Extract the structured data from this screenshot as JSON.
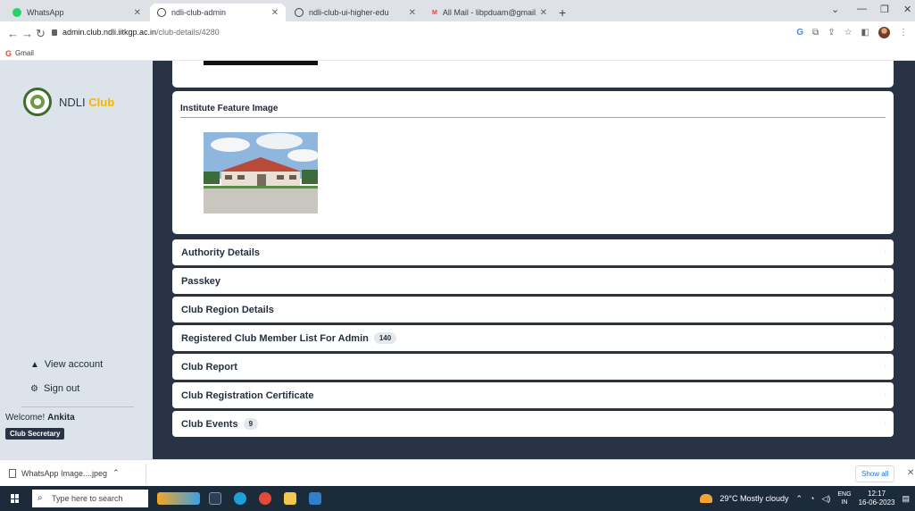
{
  "browser": {
    "tabs": [
      {
        "title": "WhatsApp",
        "favicon_color": "#25d366"
      },
      {
        "title": "ndli-club-admin",
        "favicon_color": "#3c4043"
      },
      {
        "title": "ndli-club-ui-higher-edu",
        "favicon_color": "#3c4043"
      },
      {
        "title": "All Mail - libpduam@gmail.com",
        "favicon_color": "#ea4335"
      }
    ],
    "url_host": "admin.club.ndli.iitkgp.ac.in",
    "url_path": "/club-details/4280",
    "bookmark": "Gmail"
  },
  "sidebar": {
    "brand_prefix": "NDLI",
    "brand_suffix": "Club",
    "view_account": "View account",
    "sign_out": "Sign out",
    "welcome_prefix": "Welcome!",
    "user_name": "Ankita",
    "role": "Club Secretary"
  },
  "main": {
    "feature_title": "Institute Feature Image",
    "sections": [
      {
        "label": "Authority Details",
        "count": ""
      },
      {
        "label": "Passkey",
        "count": ""
      },
      {
        "label": "Club Region Details",
        "count": ""
      },
      {
        "label": "Registered Club Member List For Admin",
        "count": "140"
      },
      {
        "label": "Club Report",
        "count": ""
      },
      {
        "label": "Club Registration Certificate",
        "count": ""
      },
      {
        "label": "Club Events",
        "count": "9"
      }
    ]
  },
  "downloads": {
    "file": "WhatsApp Image....jpeg",
    "show_all": "Show all"
  },
  "taskbar": {
    "search_placeholder": "Type here to search",
    "weather": "29°C  Mostly cloudy",
    "lang_top": "ENG",
    "lang_bottom": "IN",
    "time": "12:17",
    "date": "16-06-2023"
  }
}
